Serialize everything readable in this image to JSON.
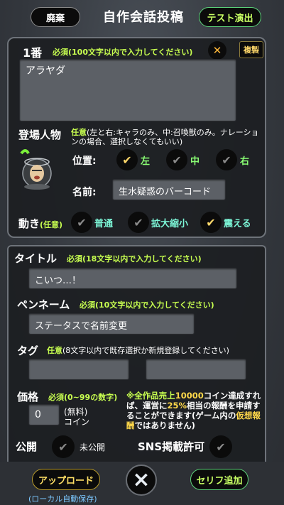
{
  "header": {
    "discard_label": "廃棄",
    "title": "自作会話投稿",
    "test_label": "テスト演出"
  },
  "dialogue": {
    "number_label": "1番",
    "required_hint": "必須(100文字以内で入力してください)",
    "copy_label": "複製",
    "text_value": "アラヤダ",
    "character_label": "登場人物",
    "character_hint_tag": "任意",
    "character_hint": "(左と右:キャラのみ、中:召喚獣のみ。ナレーションの場合、選択しなくてもいい)",
    "position_label": "位置:",
    "positions": [
      "左",
      "中",
      "右"
    ],
    "name_label": "名前:",
    "name_value": "生水疑惑のバーコード",
    "motion_label": "動き",
    "motion_tag": "(任意)",
    "motions": [
      "普通",
      "拡大縮小",
      "震える"
    ]
  },
  "form": {
    "title_label": "タイトル",
    "title_hint": "必須(18文字以内で入力してください)",
    "title_value": "こいつ…！",
    "penname_label": "ペンネーム",
    "penname_hint": "必須(10文字以内で入力してください)",
    "penname_value": "ステータスで名前変更",
    "tag_label": "タグ",
    "tag_hint_tag": "任意",
    "tag_hint": "(8文字以内で既存選択か新規登録してください)",
    "price_label": "価格",
    "price_hint": "必須(0~99の数字)",
    "price_value": "0",
    "price_free_label": "(無料)",
    "price_unit": "コイン",
    "notice_parts": [
      "※全作品売上",
      "10000",
      "コイン達成すれば、運営に",
      "25%",
      "相当の報酬を申請することができます(ゲーム内の",
      "仮想報酬",
      "ではありません)"
    ],
    "public_label": "公開",
    "public_state": "未公開",
    "sns_label": "SNS掲載許可"
  },
  "footer": {
    "upload_label": "アップロード",
    "upload_sub": "(ローカル自動保存)",
    "close_icon": "×",
    "add_line_label": "セリフ追加"
  },
  "colors": {
    "accent_green": "#c8ff50",
    "accent_yellow": "#ffd84a",
    "option_green": "#8aff74"
  }
}
